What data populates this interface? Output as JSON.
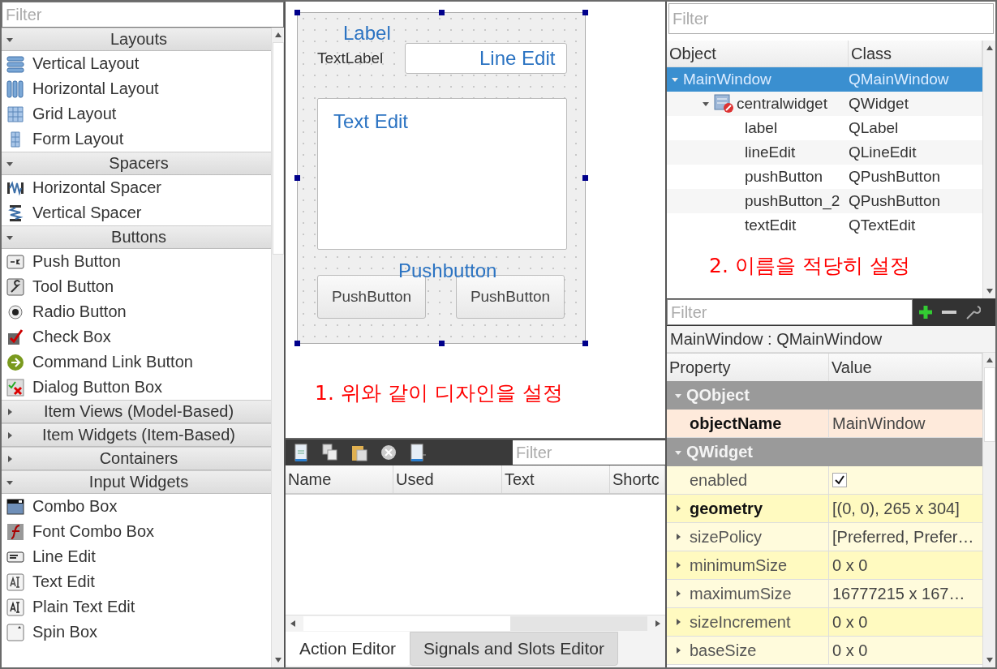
{
  "widget_box": {
    "filter": {
      "placeholder": "Filter"
    },
    "categories": [
      {
        "title": "Layouts",
        "expanded": true,
        "items": [
          "Vertical Layout",
          "Horizontal Layout",
          "Grid Layout",
          "Form Layout"
        ]
      },
      {
        "title": "Spacers",
        "expanded": true,
        "items": [
          "Horizontal Spacer",
          "Vertical Spacer"
        ]
      },
      {
        "title": "Buttons",
        "expanded": true,
        "items": [
          "Push Button",
          "Tool Button",
          "Radio Button",
          "Check Box",
          "Command Link Button",
          "Dialog Button Box"
        ]
      },
      {
        "title": "Item Views (Model-Based)",
        "expanded": false
      },
      {
        "title": "Item Widgets (Item-Based)",
        "expanded": false
      },
      {
        "title": "Containers",
        "expanded": false
      },
      {
        "title": "Input Widgets",
        "expanded": true,
        "items": [
          "Combo Box",
          "Font Combo Box",
          "Line Edit",
          "Text Edit",
          "Plain Text Edit",
          "Spin Box"
        ]
      }
    ]
  },
  "form": {
    "selected": true,
    "label": {
      "text": "TextLabel",
      "note": "Label"
    },
    "line_edit": {
      "note": "Line Edit"
    },
    "text_edit": {
      "note": "Text Edit"
    },
    "buttons": {
      "note": "Pushbutton",
      "items": [
        "PushButton",
        "PushButton"
      ]
    },
    "caption": "1. 위와 같이 디자인을 설정"
  },
  "action_editor": {
    "filter": {
      "placeholder": "Filter"
    },
    "columns": [
      "Name",
      "Used",
      "Text",
      "Shortc"
    ]
  },
  "bottom_tabs": [
    {
      "label": "Action Editor",
      "selected": true
    },
    {
      "label": "Signals and Slots Editor",
      "selected": false
    }
  ],
  "object_inspector": {
    "filter": {
      "placeholder": "Filter"
    },
    "columns": [
      "Object",
      "Class"
    ],
    "tree": [
      {
        "object": "MainWindow",
        "class": "QMainWindow",
        "selected": true,
        "expanded": true,
        "children": [
          {
            "object": "centralwidget",
            "class": "QWidget",
            "selected": false,
            "expanded": true,
            "children": [
              {
                "object": "label",
                "class": "QLabel",
                "selected": false
              },
              {
                "object": "lineEdit",
                "class": "QLineEdit",
                "selected": false
              },
              {
                "object": "pushButton",
                "class": "QPushButton",
                "selected": false
              },
              {
                "object": "pushButton_2",
                "class": "QPushButton",
                "selected": false
              },
              {
                "object": "textEdit",
                "class": "QTextEdit",
                "selected": false
              }
            ]
          }
        ]
      }
    ],
    "caption": "2. 이름을 적당히 설정"
  },
  "property_editor": {
    "filter": {
      "placeholder": "Filter"
    },
    "title": "MainWindow : QMainWindow",
    "columns": [
      "Property",
      "Value"
    ],
    "groups": [
      {
        "name": "QObject",
        "expanded": true,
        "properties": [
          {
            "kind": "text",
            "name": "objectName",
            "value": "MainWindow",
            "modified": true,
            "expandable": false
          }
        ]
      },
      {
        "name": "QWidget",
        "expanded": true,
        "properties": [
          {
            "kind": "checkbox",
            "name": "enabled",
            "checked": true,
            "modified": false,
            "expandable": false
          },
          {
            "kind": "text",
            "name": "geometry",
            "value": "[(0, 0), 265 x 304]",
            "modified": true,
            "expandable": true
          },
          {
            "kind": "text",
            "name": "sizePolicy",
            "value": "[Preferred, Prefer…",
            "modified": false,
            "expandable": true
          },
          {
            "kind": "text",
            "name": "minimumSize",
            "value": "0 x 0",
            "modified": false,
            "expandable": true
          },
          {
            "kind": "text",
            "name": "maximumSize",
            "value": "16777215 x 167…",
            "modified": false,
            "expandable": true
          },
          {
            "kind": "text",
            "name": "sizeIncrement",
            "value": "0 x 0",
            "modified": false,
            "expandable": true
          },
          {
            "kind": "text",
            "name": "baseSize",
            "value": "0 x 0",
            "modified": false,
            "expandable": true
          }
        ]
      }
    ]
  }
}
